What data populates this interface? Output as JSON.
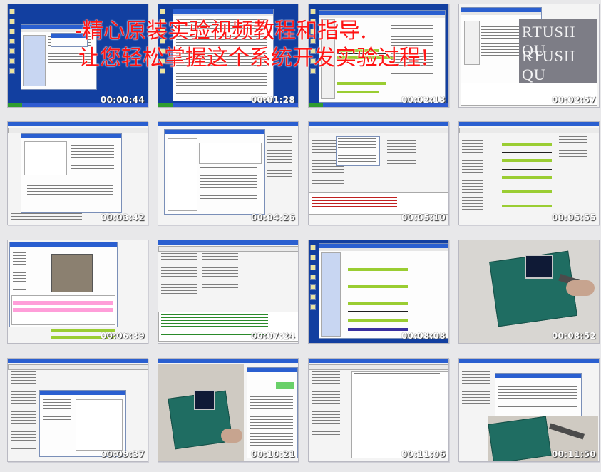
{
  "overlay": {
    "line1": "-精心原装实验视频教程和指导.",
    "line2": "让您轻松掌握这个系统开发实验过程!"
  },
  "watermark": {
    "text": "RTUSII QU"
  },
  "thumbnails": [
    {
      "timestamp": "00:00:44"
    },
    {
      "timestamp": "00:01:28"
    },
    {
      "timestamp": "00:02:13"
    },
    {
      "timestamp": "00:02:57"
    },
    {
      "timestamp": "00:03:42"
    },
    {
      "timestamp": "00:04:26"
    },
    {
      "timestamp": "00:05:10"
    },
    {
      "timestamp": "00:05:55"
    },
    {
      "timestamp": "00:06:39"
    },
    {
      "timestamp": "00:07:24"
    },
    {
      "timestamp": "00:08:08"
    },
    {
      "timestamp": "00:08:52"
    },
    {
      "timestamp": "00:09:37"
    },
    {
      "timestamp": "00:10:21"
    },
    {
      "timestamp": "00:11:06"
    },
    {
      "timestamp": "00:11:50"
    }
  ],
  "colors": {
    "overlay_text": "#ff1414",
    "desktop_blue": "#123fa0",
    "timestamp_text": "#ffffff",
    "highlight_green": "#9acd32",
    "highlight_pink": "#ff9ed9"
  }
}
